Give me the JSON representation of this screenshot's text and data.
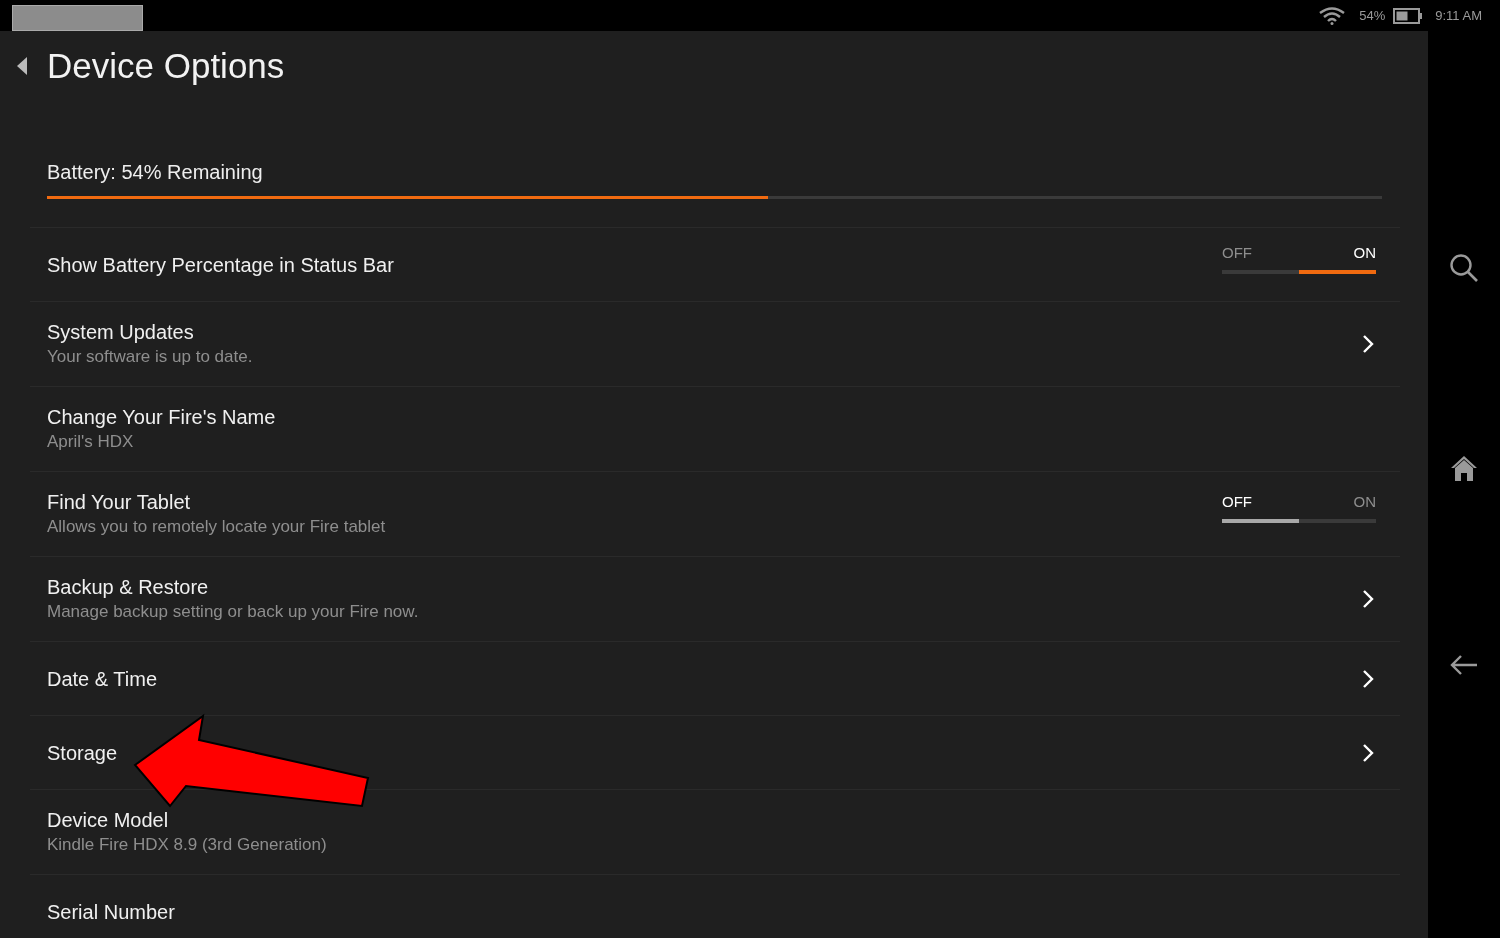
{
  "status_bar": {
    "battery_percent": "54%",
    "time": "9:11 AM"
  },
  "header": {
    "title": "Device Options"
  },
  "battery": {
    "label": "Battery: 54% Remaining",
    "level": 0.54
  },
  "rows": [
    {
      "kind": "toggle",
      "title": "Show Battery Percentage in Status Bar",
      "off_label": "OFF",
      "on_label": "ON",
      "on": true
    },
    {
      "kind": "link",
      "title": "System Updates",
      "subtitle": "Your software is up to date."
    },
    {
      "kind": "plain",
      "title": "Change Your Fire's Name",
      "subtitle": "April's HDX"
    },
    {
      "kind": "toggle",
      "title": "Find Your Tablet",
      "subtitle": "Allows you to remotely locate your Fire tablet",
      "off_label": "OFF",
      "on_label": "ON",
      "on": false
    },
    {
      "kind": "link",
      "title": "Backup & Restore",
      "subtitle": "Manage backup setting or back up your Fire now."
    },
    {
      "kind": "link",
      "title": "Date & Time"
    },
    {
      "kind": "link",
      "title": "Storage"
    },
    {
      "kind": "plain",
      "title": "Device Model",
      "subtitle": "Kindle Fire HDX 8.9 (3rd Generation)"
    },
    {
      "kind": "plain",
      "title": "Serial Number"
    }
  ]
}
